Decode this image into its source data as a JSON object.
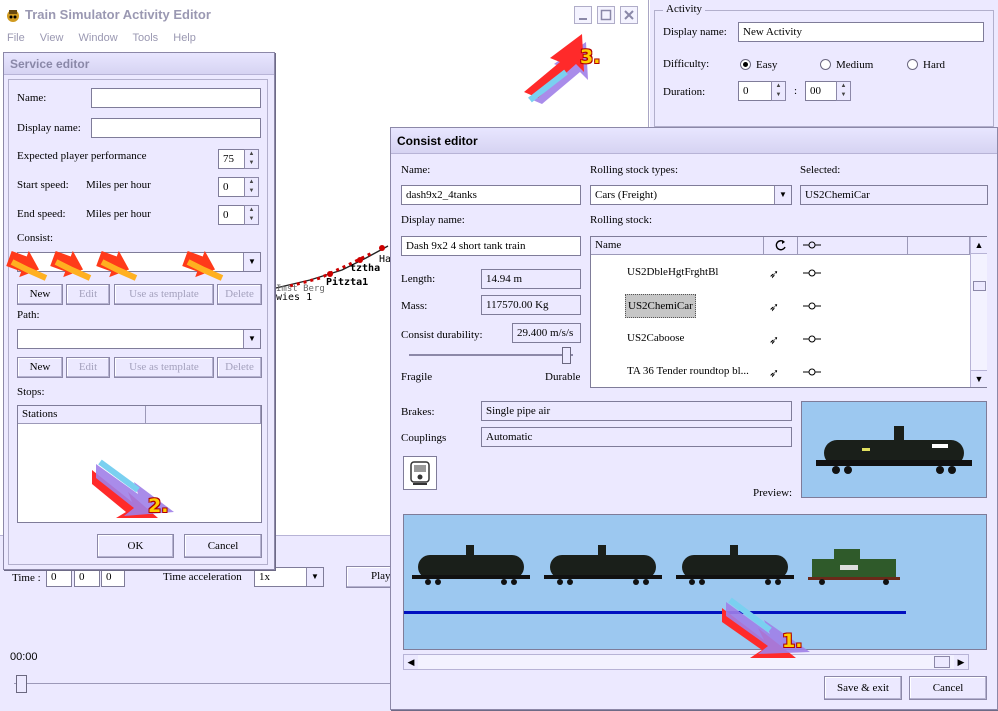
{
  "app": {
    "title": "Train Simulator Activity Editor",
    "menu": [
      "File",
      "View",
      "Window",
      "Tools",
      "Help"
    ]
  },
  "activity": {
    "group_label": "Activity",
    "display_name_label": "Display name:",
    "display_name_value": "New Activity",
    "difficulty_label": "Difficulty:",
    "difficulty_options": [
      "Easy",
      "Medium",
      "Hard"
    ],
    "difficulty_selected": "Easy",
    "duration_label": "Duration:",
    "duration_hours": "0",
    "duration_sep": ":",
    "duration_minutes": "00"
  },
  "map_labels": [
    "Hai",
    "tztha",
    "Pitzta1",
    "Imst Berg",
    "wies 1"
  ],
  "bottom": {
    "time_label": "Time :",
    "time_values": [
      "0",
      "0",
      "0"
    ],
    "accel_label": "Time acceleration",
    "accel_value": "1x",
    "play_label": "Play",
    "clock": "00:00"
  },
  "service_editor": {
    "title": "Service editor",
    "name_label": "Name:",
    "name_value": "",
    "display_name_label": "Display name:",
    "display_name_value": "",
    "expected_label": "Expected player performance",
    "expected_value": "75",
    "start_speed_label": "Start speed:",
    "end_speed_label": "End speed:",
    "speed_unit": "Miles per hour",
    "start_speed_value": "0",
    "end_speed_value": "0",
    "consist_label": "Consist:",
    "consist_value": "",
    "path_label": "Path:",
    "path_value": "",
    "btn_new": "New",
    "btn_edit": "Edit",
    "btn_template": "Use as template",
    "btn_delete": "Delete",
    "stops_label": "Stops:",
    "stops_columns": [
      "Stations",
      ""
    ],
    "ok": "OK",
    "cancel": "Cancel"
  },
  "consist_editor": {
    "title": "Consist editor",
    "name_label": "Name:",
    "name_value": "dash9x2_4tanks",
    "display_name_label": "Display name:",
    "display_name_value": "Dash 9x2 4 short tank train",
    "rolling_types_label": "Rolling stock types:",
    "rolling_types_value": "Cars (Freight)",
    "selected_label": "Selected:",
    "selected_value": "US2ChemiCar",
    "rolling_stock_label": "Rolling stock:",
    "column_name": "Name",
    "stock_items": [
      "US2DbleHgtFrghtBl",
      "US2ChemiCar",
      "US2Caboose",
      "TA 36 Tender roundtop bl..."
    ],
    "stock_selected_index": 1,
    "length_label": "Length:",
    "length_value": "14.94 m",
    "mass_label": "Mass:",
    "mass_value": "117570.00 Kg",
    "durability_label": "Consist durability:",
    "durability_value": "29.400 m/s/s",
    "durability_level": 0.98,
    "fragile_label": "Fragile",
    "durable_label": "Durable",
    "brakes_label": "Brakes:",
    "brakes_value": "Single pipe air",
    "couplings_label": "Couplings",
    "couplings_value": "Automatic",
    "preview_label": "Preview:",
    "save_exit": "Save & exit",
    "cancel": "Cancel"
  },
  "callouts": [
    "1.",
    "2.",
    "3."
  ],
  "colors": {
    "window_bg": "#ece9ff",
    "preview_bg": "#9cc8f0",
    "track_line": "#0010c0",
    "arrow_red": "#ff2020",
    "arrow_orange": "#ffa500",
    "arrow_purple": "#a070e0"
  }
}
